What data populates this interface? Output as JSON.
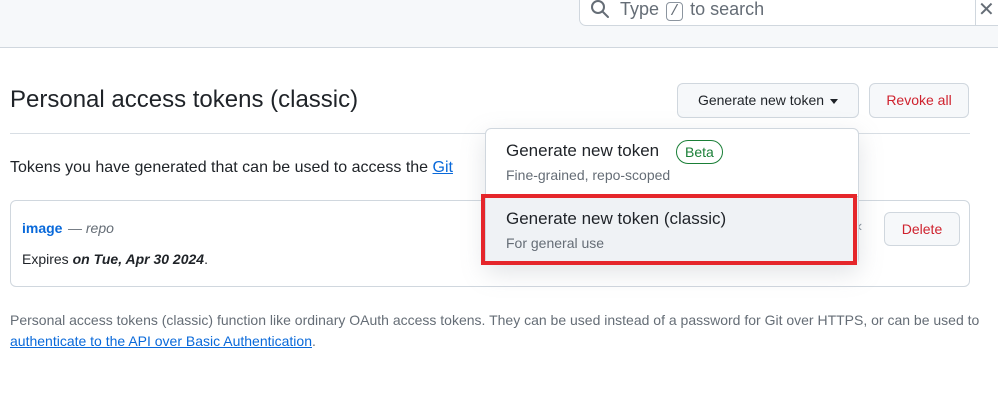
{
  "header": {
    "search": {
      "placeholder_before": "Type",
      "shortcut_key": "/",
      "placeholder_after": "to search"
    }
  },
  "main": {
    "title": "Personal access tokens (classic)",
    "generate_button_label": "Generate new token",
    "revoke_button_label": "Revoke all",
    "intro_text": "Tokens you have generated that can be used to access the ",
    "intro_link": "Git",
    "token": {
      "name": "image",
      "scope_separator": " — ",
      "scope": "repo",
      "expires_prefix": "Expires ",
      "expires_value": "on Tue, Apr 30 2024",
      "expires_suffix": ".",
      "delete_label": "Delete"
    },
    "footer": {
      "text_before": "Personal access tokens (classic) function like ordinary OAuth access tokens. They can be used instead of a password for Git over HTTPS, or can be used to ",
      "link": "authenticate to the API over Basic Authentication",
      "text_after": "."
    }
  },
  "dropdown": {
    "items": [
      {
        "title": "Generate new token",
        "badge": "Beta",
        "subtitle": "Fine-grained, repo-scoped"
      },
      {
        "title": "Generate new token (classic)",
        "subtitle": "For general use"
      }
    ]
  },
  "colors": {
    "accent_link": "#0969da",
    "danger": "#cf222e",
    "beta_green": "#1a7f37",
    "highlight_red": "#e5262b"
  },
  "icons": [
    "search-icon",
    "caret-down-icon",
    "close-icon",
    "chevron-left-icon"
  ]
}
